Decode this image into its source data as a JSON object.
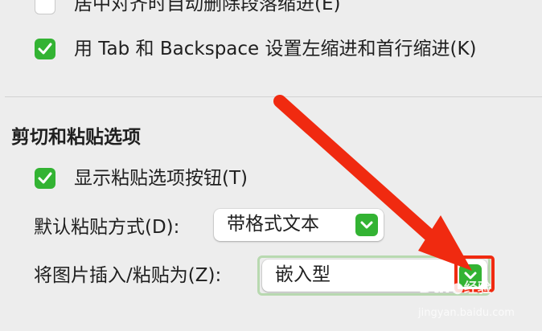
{
  "options": {
    "center_align_remove_indent": "居中对齐时自动删除段落缩进(E)",
    "tab_backspace_indent": "用 Tab 和 Backspace 设置左缩进和首行缩进(K)"
  },
  "cut_paste": {
    "section_title": "剪切和粘贴选项",
    "show_paste_button": "显示粘贴选项按钮(T)",
    "default_paste_label": "默认粘贴方式(D):",
    "default_paste_value": "带格式文本",
    "insert_picture_label": "将图片插入/粘贴为(Z):",
    "insert_picture_value": "嵌入型"
  },
  "annotation": {
    "arrow_color": "#f02a10"
  },
  "watermark": {
    "brand_text": "Bai",
    "brand_suffix": "经验",
    "url": "jingyan.baidu.com"
  },
  "colors": {
    "check_green": "#33b333",
    "background": "#ededed"
  }
}
